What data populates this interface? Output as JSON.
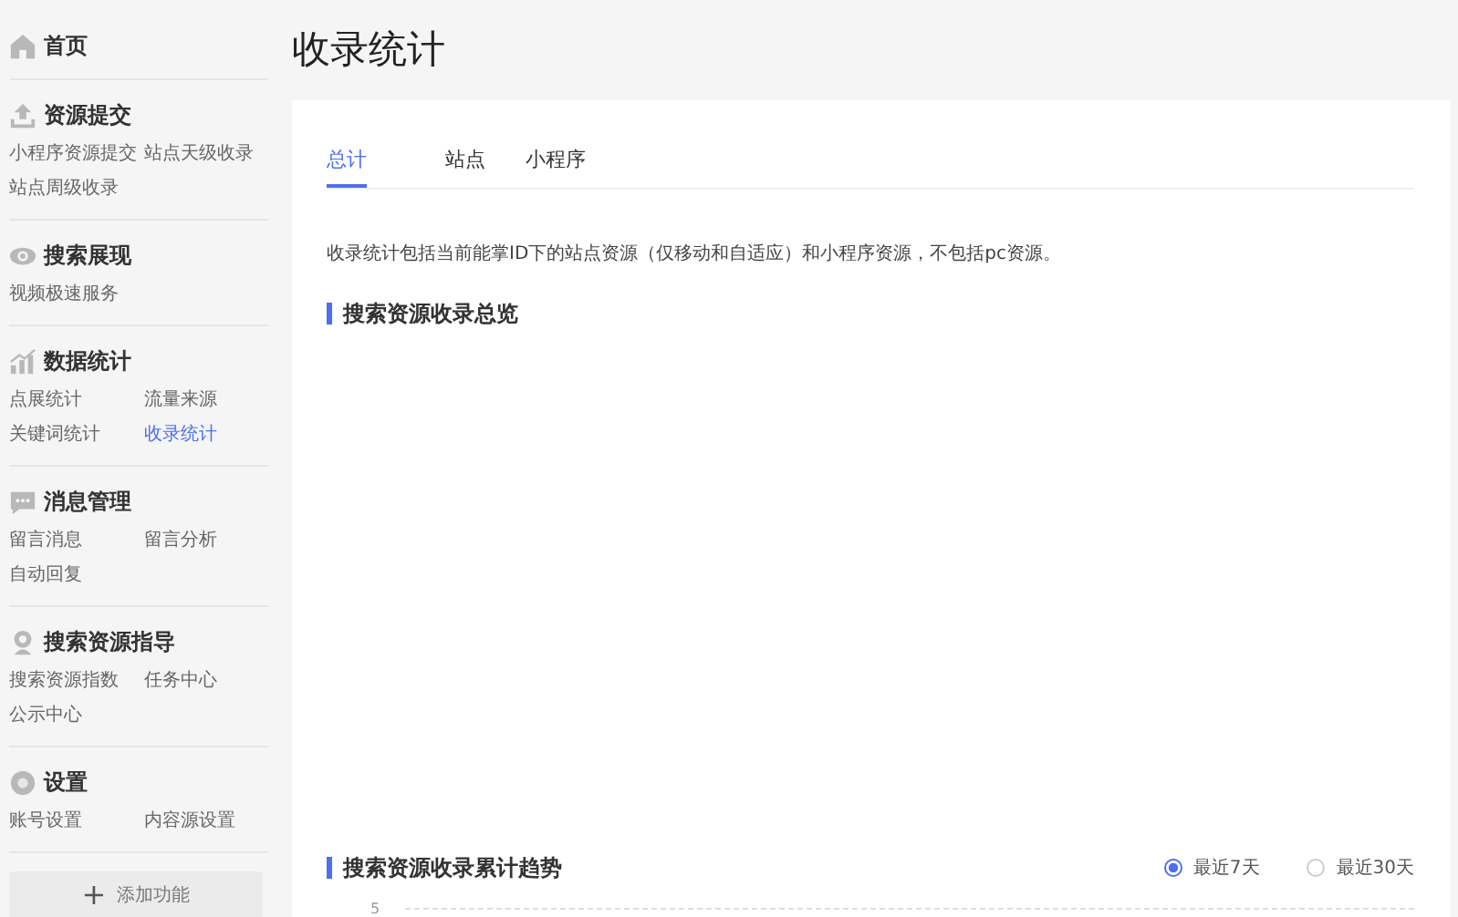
{
  "sidebar": {
    "sections": [
      {
        "title": "首页"
      },
      {
        "title": "资源提交",
        "items": [
          {
            "label": "小程序资源提交",
            "selected": false
          },
          {
            "label": "站点天级收录",
            "selected": false
          },
          {
            "label": "站点周级收录",
            "selected": false
          }
        ]
      },
      {
        "title": "搜索展现",
        "items": [
          {
            "label": "视频极速服务",
            "selected": false
          }
        ]
      },
      {
        "title": "数据统计",
        "items": [
          {
            "label": "点展统计",
            "selected": false
          },
          {
            "label": "流量来源",
            "selected": false
          },
          {
            "label": "关键词统计",
            "selected": false
          },
          {
            "label": "收录统计",
            "selected": true
          }
        ]
      },
      {
        "title": "消息管理",
        "items": [
          {
            "label": "留言消息",
            "selected": false
          },
          {
            "label": "留言分析",
            "selected": false
          },
          {
            "label": "自动回复",
            "selected": false
          }
        ]
      },
      {
        "title": "搜索资源指导",
        "items": [
          {
            "label": "搜索资源指数",
            "selected": false
          },
          {
            "label": "任务中心",
            "selected": false
          },
          {
            "label": "公示中心",
            "selected": false
          }
        ]
      },
      {
        "title": "设置",
        "items": [
          {
            "label": "账号设置",
            "selected": false
          },
          {
            "label": "内容源设置",
            "selected": false
          }
        ]
      }
    ],
    "add_button": {
      "icon": "+",
      "label": "添加功能"
    }
  },
  "page_title": "收录统计",
  "tabs": [
    {
      "label": "总计",
      "selected": true
    },
    {
      "label": "站点",
      "selected": false
    },
    {
      "label": "小程序",
      "selected": false
    }
  ],
  "description": "收录统计包括当前能掌ID下的站点资源（仅移动和自适应）和小程序资源，不包括pc资源。",
  "overview": {
    "heading": "搜索资源收录总览"
  },
  "trend": {
    "heading": "搜索资源收录累计趋势",
    "ranges": [
      {
        "label": "最近7天",
        "selected": true
      },
      {
        "label": "最近30天",
        "selected": false
      }
    ],
    "y_axis_label": "5"
  }
}
